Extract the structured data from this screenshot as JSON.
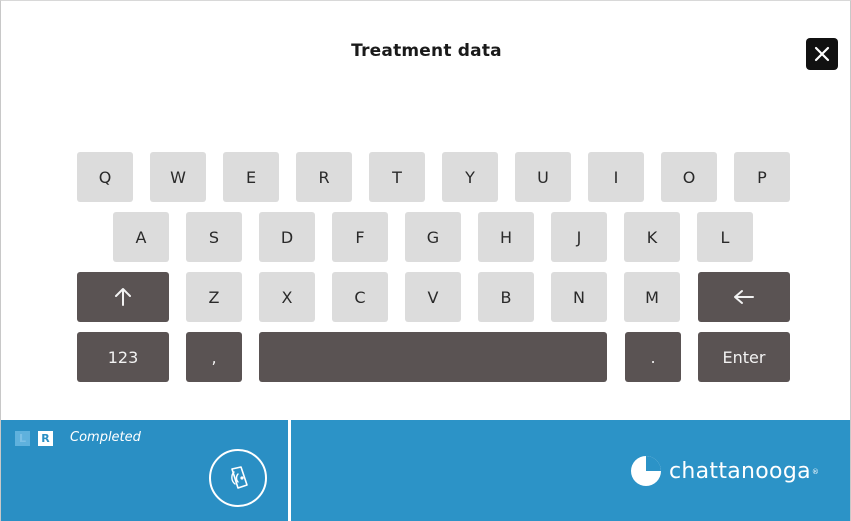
{
  "header": {
    "title": "Treatment data",
    "close_icon": "close-icon"
  },
  "keyboard": {
    "row1": [
      "Q",
      "W",
      "E",
      "R",
      "T",
      "Y",
      "U",
      "I",
      "O",
      "P"
    ],
    "row2": [
      "A",
      "S",
      "D",
      "F",
      "G",
      "H",
      "J",
      "K",
      "L"
    ],
    "row3": [
      "Z",
      "X",
      "C",
      "V",
      "B",
      "N",
      "M"
    ],
    "shift_icon": "arrow-up-icon",
    "backspace_icon": "arrow-left-icon",
    "numbers_label": "123",
    "comma_label": ",",
    "period_label": ".",
    "enter_label": "Enter",
    "colors": {
      "light_key": "#dcdcdc",
      "dark_key": "#5a5353"
    }
  },
  "footer": {
    "left_label": "L",
    "right_label": "R",
    "status": "Completed",
    "device_icon": "applicator-icon",
    "brand": "chattanooga",
    "brand_mark": "®",
    "colors": {
      "background": "#2c93c7"
    }
  }
}
